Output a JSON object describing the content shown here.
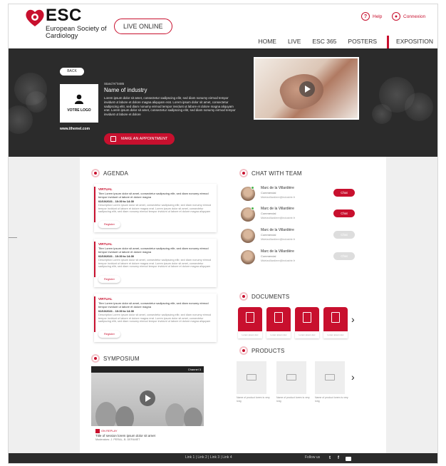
{
  "header": {
    "logo_text": "ESC",
    "logo_sub": "European Society of Cardiology",
    "live_label": "LIVE ONLINE",
    "help_label": "Help",
    "connexion_label": "Connexion",
    "nav": [
      "HOME",
      "LIVE",
      "ESC 365",
      "POSTERS",
      "EXPOSITION"
    ],
    "active_nav": "EXPOSITION",
    "accent": "#c8102e"
  },
  "banner": {
    "back_label": "BACK",
    "logo_label": "VOTRE LOGO",
    "url": "www.ithemel.com",
    "stand_number": "Stand N°0485",
    "stand_name": "Name of industry",
    "description": "Lorem ipsum dolor sit amet, consectetur sadipscing elitr, sed diam nonumy eirmod tempor invidunt ut labore et dolore magna aliquyam erat. Lorem ipsum dolor sit amet, consectetur sadipscing elitr, sed diam nonumy eirmod tempor invidunt ut labore et dolore magna aliquyam erat. Lorem ipsum dolor sit amet, consectetur sadipscing elitr, sed diam nonumy eirmod tempor invidunt ut labore et dolore",
    "appointment_label": "MAKE AN APPOINTMENT"
  },
  "agenda": {
    "title": "AGENDA",
    "items": [
      {
        "tag": "VIRTUAL",
        "title": "Titre Lorem ipsum dolor sit amet, consectetur sadipscing elitr, sed diam nonumy eirmod tempor invidunt ut labore et dolore magna",
        "date": "02/10/2021 - 10:30 to 14:30",
        "text": "Description Lorem ipsum dolor sit amet, consectetur sadipscing elitr, sed diam nonumy eirmod tempor invidunt ut labore et dolore magna erat. Lorem ipsum dolor sit amet, consectetur sadipscing elitr, sed diam nonumy eirmod tempor invidunt ut labore et dolore magna aliquyam",
        "register": "Register"
      },
      {
        "tag": "VIRTUAL",
        "title": "Titre Lorem ipsum dolor sit amet, consectetur sadipscing elitr, sed diam nonumy eirmod tempor invidunt ut labore et dolore magna",
        "date": "02/10/2021 - 10:30 to 14:30",
        "text": "Description Lorem ipsum dolor sit amet, consectetur sadipscing elitr, sed diam nonumy eirmod tempor invidunt ut labore et dolore magna erat. Lorem ipsum dolor sit amet, consectetur sadipscing elitr, sed diam nonumy eirmod tempor invidunt ut labore et dolore magna aliquyam",
        "register": "Register"
      },
      {
        "tag": "VIRTUAL",
        "title": "Titre Lorem ipsum dolor sit amet, consectetur sadipscing elitr, sed diam nonumy eirmod tempor invidunt ut labore et dolore magna",
        "date": "02/10/2021 - 10:30 to 14:30",
        "text": "Description Lorem ipsum dolor sit amet, consectetur sadipscing elitr, sed diam nonumy eirmod tempor invidunt ut labore et dolore magna erat. Lorem ipsum dolor sit amet, consectetur sadipscing elitr, sed diam nonumy eirmod tempor invidunt ut labore et dolore magna aliquyam",
        "register": "Register"
      }
    ]
  },
  "chat": {
    "title": "CHAT WITH TEAM",
    "members": [
      {
        "name": "Marc de la Villardière",
        "role": "Commercial",
        "email": "Mdelavillardiere@industrie.fr",
        "button": "Chat",
        "available": true
      },
      {
        "name": "Marc de la Villardière",
        "role": "Commercial",
        "email": "Mdelavillardiere@industrie.fr",
        "button": "Chat",
        "available": true
      },
      {
        "name": "Marc de la Villardière",
        "role": "Commercial",
        "email": "Mdelavillardiere@industrie.fr",
        "button": "Chat",
        "available": false
      },
      {
        "name": "Marc de la Villardière",
        "role": "Commercial",
        "email": "Mdelavillardiere@industrie.fr",
        "button": "Chat",
        "available": false
      }
    ]
  },
  "documents": {
    "title": "DOCUMENTS",
    "items": [
      "Lorem ipsum doc",
      "Lorem ipsum doc",
      "Lorem ipsum doc",
      "Lorem ipsum doc"
    ]
  },
  "products": {
    "title": "PRODUCTS",
    "items": [
      "Name of product lorem is very long",
      "Name of product lorem is very long",
      "Name of product lorem is very long"
    ]
  },
  "symposium": {
    "title": "SYMPOSIUM",
    "channel": "Channel 3",
    "tag": "ON REPLAY",
    "session_title": "Title of session lorem ipsum dolor sit amet",
    "moderators": "Moderators: J. PERAL, B. DEFAMET"
  },
  "footer": {
    "links": "Link 1 | Link 2 | Link 3 | Link 4",
    "follow_label": "Follow us"
  }
}
